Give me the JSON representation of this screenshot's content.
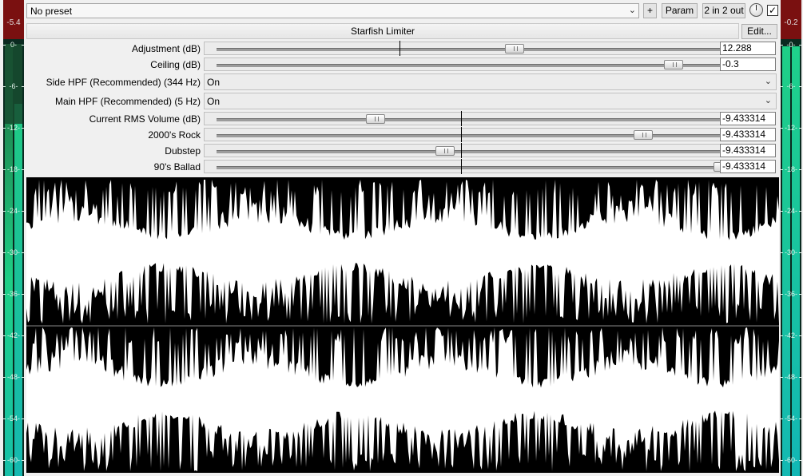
{
  "meters": {
    "left": {
      "peak": "-5.4",
      "scale": [
        "0-",
        "-6-",
        "-12-",
        "-18-",
        "-24-",
        "-30-",
        "-36-",
        "-42-",
        "-48-",
        "-54-",
        "-60-"
      ]
    },
    "right": {
      "peak": "-0.2",
      "scale": [
        "-0-",
        "-6-",
        "-12-",
        "-18-",
        "-24-",
        "-30-",
        "-36-",
        "-42-",
        "-48-",
        "-54-",
        "-60-"
      ]
    }
  },
  "toolbar": {
    "preset": "No preset",
    "add_label": "+",
    "param_label": "Param",
    "io_label": "2 in 2 out",
    "bypass_checked": "✓"
  },
  "plugin": {
    "title": "Starfish Limiter",
    "edit_label": "Edit..."
  },
  "params": [
    {
      "label": "Adjustment (dB)",
      "value": "12.288",
      "type": "slider",
      "position": 0.58
    },
    {
      "label": "Ceiling (dB)",
      "value": "-0.3",
      "type": "slider",
      "position": 0.9
    },
    {
      "label": "Side HPF (Recommended) (344 Hz)",
      "value": "On",
      "type": "dropdown"
    },
    {
      "label": "Main HPF (Recommended) (5 Hz)",
      "value": "On",
      "type": "dropdown"
    },
    {
      "label": "Current RMS Volume (dB)",
      "value": "-9.433314",
      "type": "slider",
      "position": 0.3
    },
    {
      "label": "2000's Rock",
      "value": "-9.433314",
      "type": "slider",
      "position": 0.84
    },
    {
      "label": "Dubstep",
      "value": "-9.433314",
      "type": "slider",
      "position": 0.44
    },
    {
      "label": "90's Ballad",
      "value": "-9.433314",
      "type": "slider",
      "position": 1.0
    }
  ],
  "colors": {
    "meter_green": "#1fcf86",
    "meter_teal": "#14b9b3",
    "peak_red": "#7a1010",
    "wave_bg": "#000000",
    "wave_fg": "#ffffff"
  }
}
